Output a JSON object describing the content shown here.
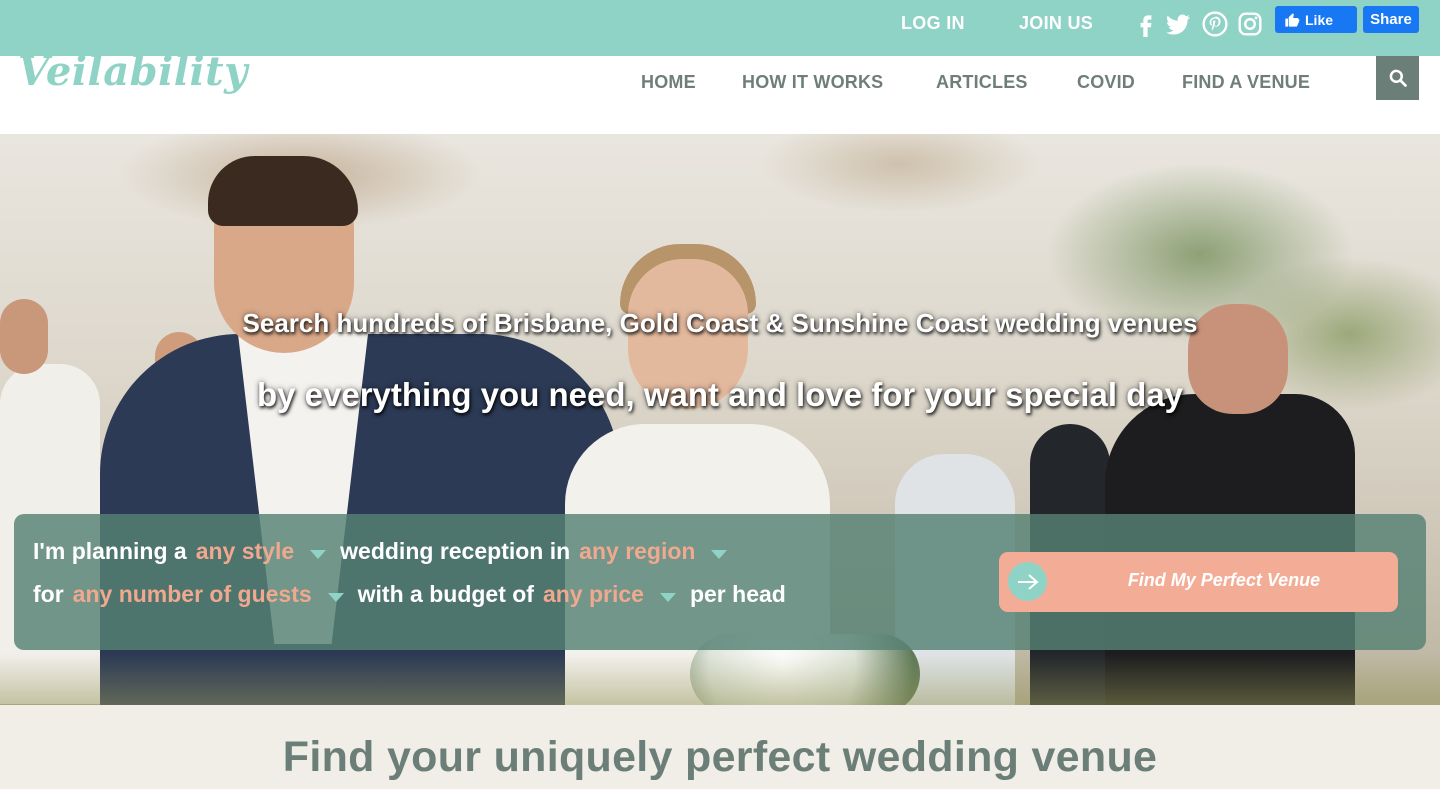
{
  "topbar": {
    "login": "LOG IN",
    "join": "JOIN US",
    "social_icons": [
      "facebook-icon",
      "twitter-icon",
      "pinterest-icon",
      "instagram-icon"
    ],
    "fb_like": "Like",
    "fb_share": "Share"
  },
  "header": {
    "logo": "Veilability",
    "nav": {
      "home": "HOME",
      "how": "HOW IT WORKS",
      "articles": "ARTICLES",
      "covid": "COVID",
      "find": "FIND A VENUE"
    }
  },
  "hero": {
    "line1": "Search hundreds of Brisbane, Gold Coast & Sunshine Coast wedding venues",
    "line2": "by everything you need, want and love for your special day"
  },
  "search": {
    "t1": "I'm planning a",
    "style": "any style",
    "t2": "wedding reception in",
    "region": "any region",
    "t3": "for",
    "guests": "any number of guests",
    "t4": "with a budget of",
    "price": "any price",
    "t5": "per head",
    "cta": "Find My Perfect Venue"
  },
  "bottom": {
    "title": "Find your uniquely perfect wedding venue"
  },
  "colors": {
    "brand_teal": "#8fd3c6",
    "accent_peach": "#f3ad97",
    "nav_grey": "#6f7f78",
    "facebook_blue": "#1877f2"
  }
}
